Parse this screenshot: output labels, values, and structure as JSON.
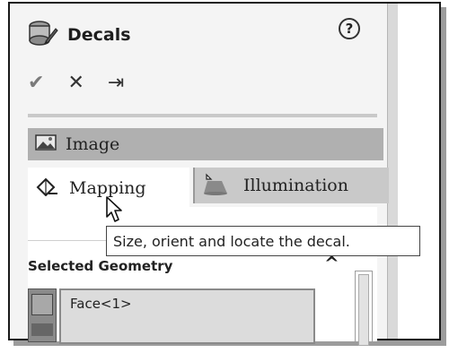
{
  "header": {
    "title": "Decals",
    "help_icon": "help-icon",
    "help_glyph": "?",
    "decals_icon": "decals-icon"
  },
  "actions": {
    "ok_glyph": "✔",
    "cancel_glyph": "✕",
    "pin_glyph": "⇥"
  },
  "image_section": {
    "label": "Image"
  },
  "tabs": [
    {
      "label": "Mapping",
      "icon": "mapping-icon",
      "selected": true
    },
    {
      "label": "Illumination",
      "icon": "illumination-icon",
      "selected": false
    }
  ],
  "tooltip": {
    "text": "Size, orient and locate the decal."
  },
  "selected_geometry": {
    "title": "Selected Geometry",
    "items": [
      "Face<1>"
    ],
    "collapse_glyph": "^"
  },
  "colors": {
    "panel_bg": "#f4f4f4",
    "image_bar": "#b0b0b0",
    "tab_inactive": "#c9c9c9"
  }
}
